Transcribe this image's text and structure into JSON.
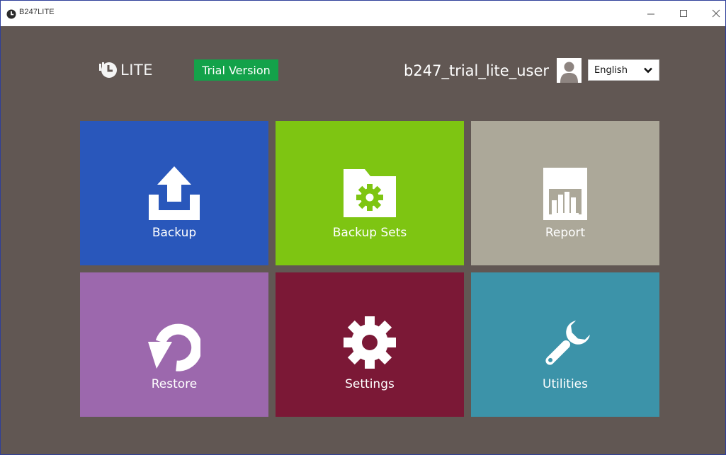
{
  "window": {
    "title": "B247LITE",
    "icon": "clock-logo-icon",
    "controls": [
      "minimize-icon",
      "maximize-icon",
      "close-icon"
    ]
  },
  "header": {
    "logo_text": "LITE",
    "trial_badge": "Trial Version",
    "username": "b247_trial_lite_user",
    "avatar_icon": "user-silhouette-icon",
    "language": {
      "selected": "English",
      "icon": "chevron-down-icon"
    }
  },
  "tiles": [
    {
      "id": "backup",
      "label": "Backup",
      "icon": "upload-tray-icon",
      "color": "#2957bb"
    },
    {
      "id": "backup-sets",
      "label": "Backup Sets",
      "icon": "folder-gear-icon",
      "color": "#7ec512"
    },
    {
      "id": "report",
      "label": "Report",
      "icon": "bar-chart-icon",
      "color": "#aca899"
    },
    {
      "id": "restore",
      "label": "Restore",
      "icon": "undo-arrow-icon",
      "color": "#9c68ad"
    },
    {
      "id": "settings",
      "label": "Settings",
      "icon": "gear-icon",
      "color": "#7b1836"
    },
    {
      "id": "utilities",
      "label": "Utilities",
      "icon": "wrench-icon",
      "color": "#3c93a9"
    }
  ],
  "colors": {
    "background": "#615753",
    "trial_badge": "#13a24a"
  }
}
